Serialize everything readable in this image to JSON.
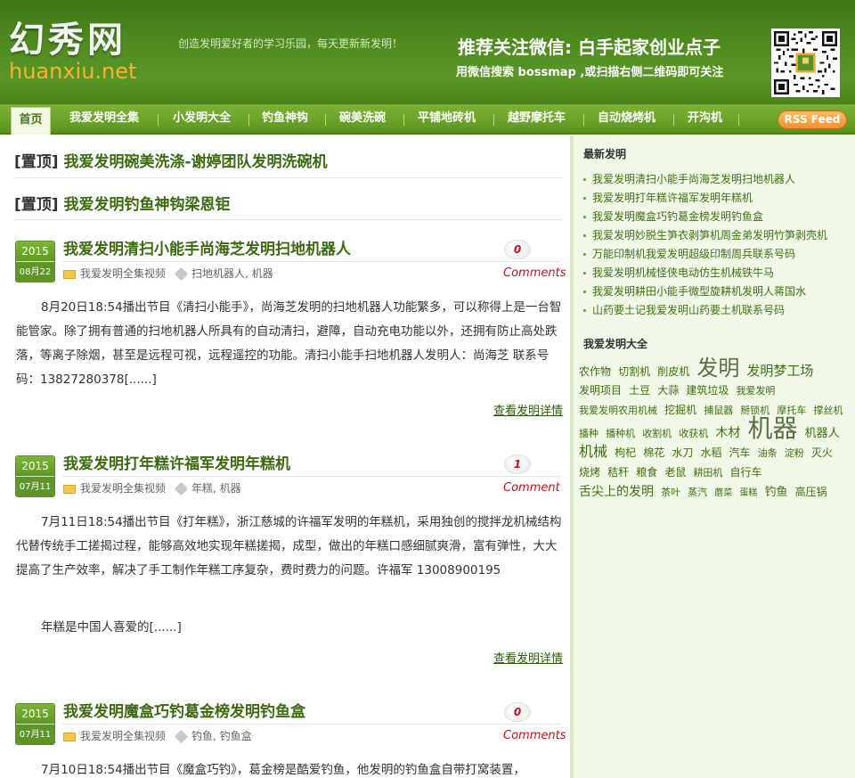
{
  "header": {
    "logo_cn": "幻秀网",
    "logo_en": "huanxiu.net",
    "slogan": "创造发明爱好者的学习乐园，每天更新新发明！",
    "promo_title": "推荐关注微信: 白手起家创业点子",
    "promo_sub": "用微信搜索 bossmap ,或扫描右侧二维码即可关注",
    "qr_icon": "qr-code-icon"
  },
  "nav": {
    "home": "首页",
    "items": [
      "我爱发明全集",
      "小发明大全",
      "钓鱼神钩",
      "碗美洗碗",
      "平铺地砖机",
      "越野摩托车",
      "自动烧烤机",
      "开沟机"
    ],
    "rss": "RSS Feed"
  },
  "sticky": [
    {
      "tag": "[置顶]",
      "title": "我爱发明碗美洗涤-谢婷团队发明洗碗机"
    },
    {
      "tag": "[置顶]",
      "title": "我爱发明钓鱼神钩梁恩钜"
    }
  ],
  "posts": [
    {
      "year": "2015",
      "date": "08月22",
      "title": "我爱发明清扫小能手尚海芝发明扫地机器人",
      "category": "我爱发明全集视频",
      "tags": "扫地机器人, 机器",
      "comment_count": "0",
      "comment_label": "Comments",
      "excerpt": "8月20日18:54播出节目《清扫小能手》，尚海芝发明的扫地机器人功能繁多，可以称得上是一台智能管家。除了拥有普通的扫地机器人所具有的自动清扫，避障，自动充电功能以外，还拥有防止高处跌落，等离子除烟，甚至是远程可视，远程遥控的功能。清扫小能手扫地机器人发明人：尚海芝 联系号码：13827280378[......]",
      "more": "查看发明详情"
    },
    {
      "year": "2015",
      "date": "07月11",
      "title": "我爱发明打年糕许福军发明年糕机",
      "category": "我爱发明全集视频",
      "tags": "年糕, 机器",
      "comment_count": "1",
      "comment_label": "Comment",
      "excerpt": "7月11日18:54播出节目《打年糕》，浙江慈城的许福军发明的年糕机，采用独创的搅拌龙机械结构代替传统手工搓揭过程，能够高效地实现年糕搓揭，成型，做出的年糕口感细腻爽滑，富有弹性，大大提高了生产效率，解决了手工制作年糕工序复杂，费时费力的问题。许福军 13008900195",
      "excerpt2": "年糕是中国人喜爱的[......]",
      "more": "查看发明详情"
    },
    {
      "year": "2015",
      "date": "07月11",
      "title": "我爱发明魔盒巧钓葛金榜发明钓鱼盒",
      "category": "我爱发明全集视频",
      "tags": "钓鱼, 钓鱼盒",
      "comment_count": "0",
      "comment_label": "Comments",
      "excerpt": "7月10日18:54播出节目《魔盒巧钓》，葛金榜是酷爱钓鱼，他发明的钓鱼盒自带打窝装置，"
    }
  ],
  "sidebar": {
    "latest_title": "最新发明",
    "latest": [
      "我爱发明清扫小能手尚海芝发明扫地机器人",
      "我爱发明打年糕许福军发明年糕机",
      "我爱发明魔盒巧钓葛金榜发明钓鱼盒",
      "我爱发明妙脱生笋衣剥笋机周金弟发明竹笋剥壳机",
      "万能印制机我爱发明超级印制周兵联系号码",
      "我爱发明机械怪侠电动仿生机械铁牛马",
      "我爱发明耕田小能手微型旋耕机发明人蒋国水",
      "山药要土记我爱发明山药要土机联系号码"
    ],
    "cloud_title": "我爱发明大全",
    "cloud": [
      {
        "t": "农作物",
        "s": 12
      },
      {
        "t": "切割机",
        "s": 12
      },
      {
        "t": "削皮机",
        "s": 12
      },
      {
        "t": "发明",
        "s": 24
      },
      {
        "t": "发明梦工场",
        "s": 15
      },
      {
        "t": "发明项目",
        "s": 12
      },
      {
        "t": "土豆",
        "s": 12
      },
      {
        "t": "大蒜",
        "s": 12
      },
      {
        "t": "建筑垃圾",
        "s": 12
      },
      {
        "t": "我爱发明",
        "s": 11
      },
      {
        "t": "我爱发明农用机械",
        "s": 11
      },
      {
        "t": "挖掘机",
        "s": 12
      },
      {
        "t": "捕鼠器",
        "s": 11
      },
      {
        "t": "掰锁机",
        "s": 11
      },
      {
        "t": "摩托车",
        "s": 11
      },
      {
        "t": "撑丝机",
        "s": 11
      },
      {
        "t": "播种",
        "s": 11
      },
      {
        "t": "播种机",
        "s": 11
      },
      {
        "t": "收割机",
        "s": 11
      },
      {
        "t": "收获机",
        "s": 11
      },
      {
        "t": "木材",
        "s": 14
      },
      {
        "t": "机器",
        "s": 28
      },
      {
        "t": "机器人",
        "s": 13
      },
      {
        "t": "机械",
        "s": 16
      },
      {
        "t": "枸杞",
        "s": 12
      },
      {
        "t": "棉花",
        "s": 12
      },
      {
        "t": "水刀",
        "s": 12
      },
      {
        "t": "水稻",
        "s": 12
      },
      {
        "t": "汽车",
        "s": 12
      },
      {
        "t": "油条",
        "s": 11
      },
      {
        "t": "淀粉",
        "s": 11
      },
      {
        "t": "灭火",
        "s": 12
      },
      {
        "t": "烧烤",
        "s": 12
      },
      {
        "t": "秸秆",
        "s": 12
      },
      {
        "t": "粮食",
        "s": 12
      },
      {
        "t": "老鼠",
        "s": 12
      },
      {
        "t": "耕田机",
        "s": 11
      },
      {
        "t": "自行车",
        "s": 12
      },
      {
        "t": "舌尖上的发明",
        "s": 14
      },
      {
        "t": "茶叶",
        "s": 11
      },
      {
        "t": "蒸汽",
        "s": 11
      },
      {
        "t": "蘑菜",
        "s": 10
      },
      {
        "t": "蛋糕",
        "s": 10
      },
      {
        "t": "钓鱼",
        "s": 13
      },
      {
        "t": "高压锅",
        "s": 12
      }
    ]
  }
}
